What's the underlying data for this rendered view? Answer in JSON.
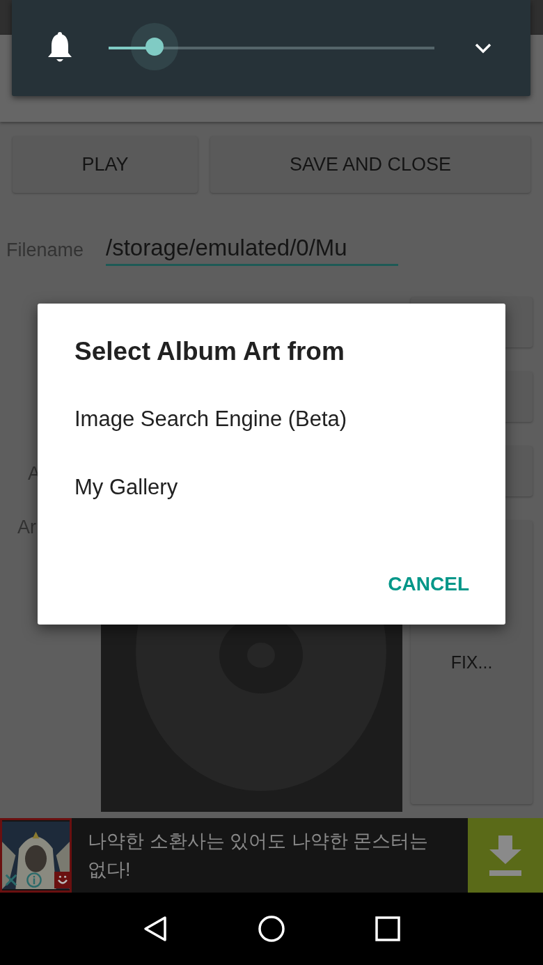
{
  "volume_panel": {
    "level": 0.14
  },
  "buttons": [
    {
      "label": "PLAY"
    },
    {
      "label": "SAVE AND CLOSE"
    }
  ],
  "filename": {
    "label": "Filename",
    "value": "/storage/emulated/0/Mu"
  },
  "side_labels": [
    "A",
    "Ar"
  ],
  "fix_button": {
    "label": "FIX..."
  },
  "dialog": {
    "title": "Select Album Art from",
    "options": [
      "Image Search Engine (Beta)",
      "My Gallery"
    ],
    "cancel": "CANCEL"
  },
  "ad": {
    "text": "나약한 소환사는 있어도 나약한 몬스터는 없다!"
  }
}
